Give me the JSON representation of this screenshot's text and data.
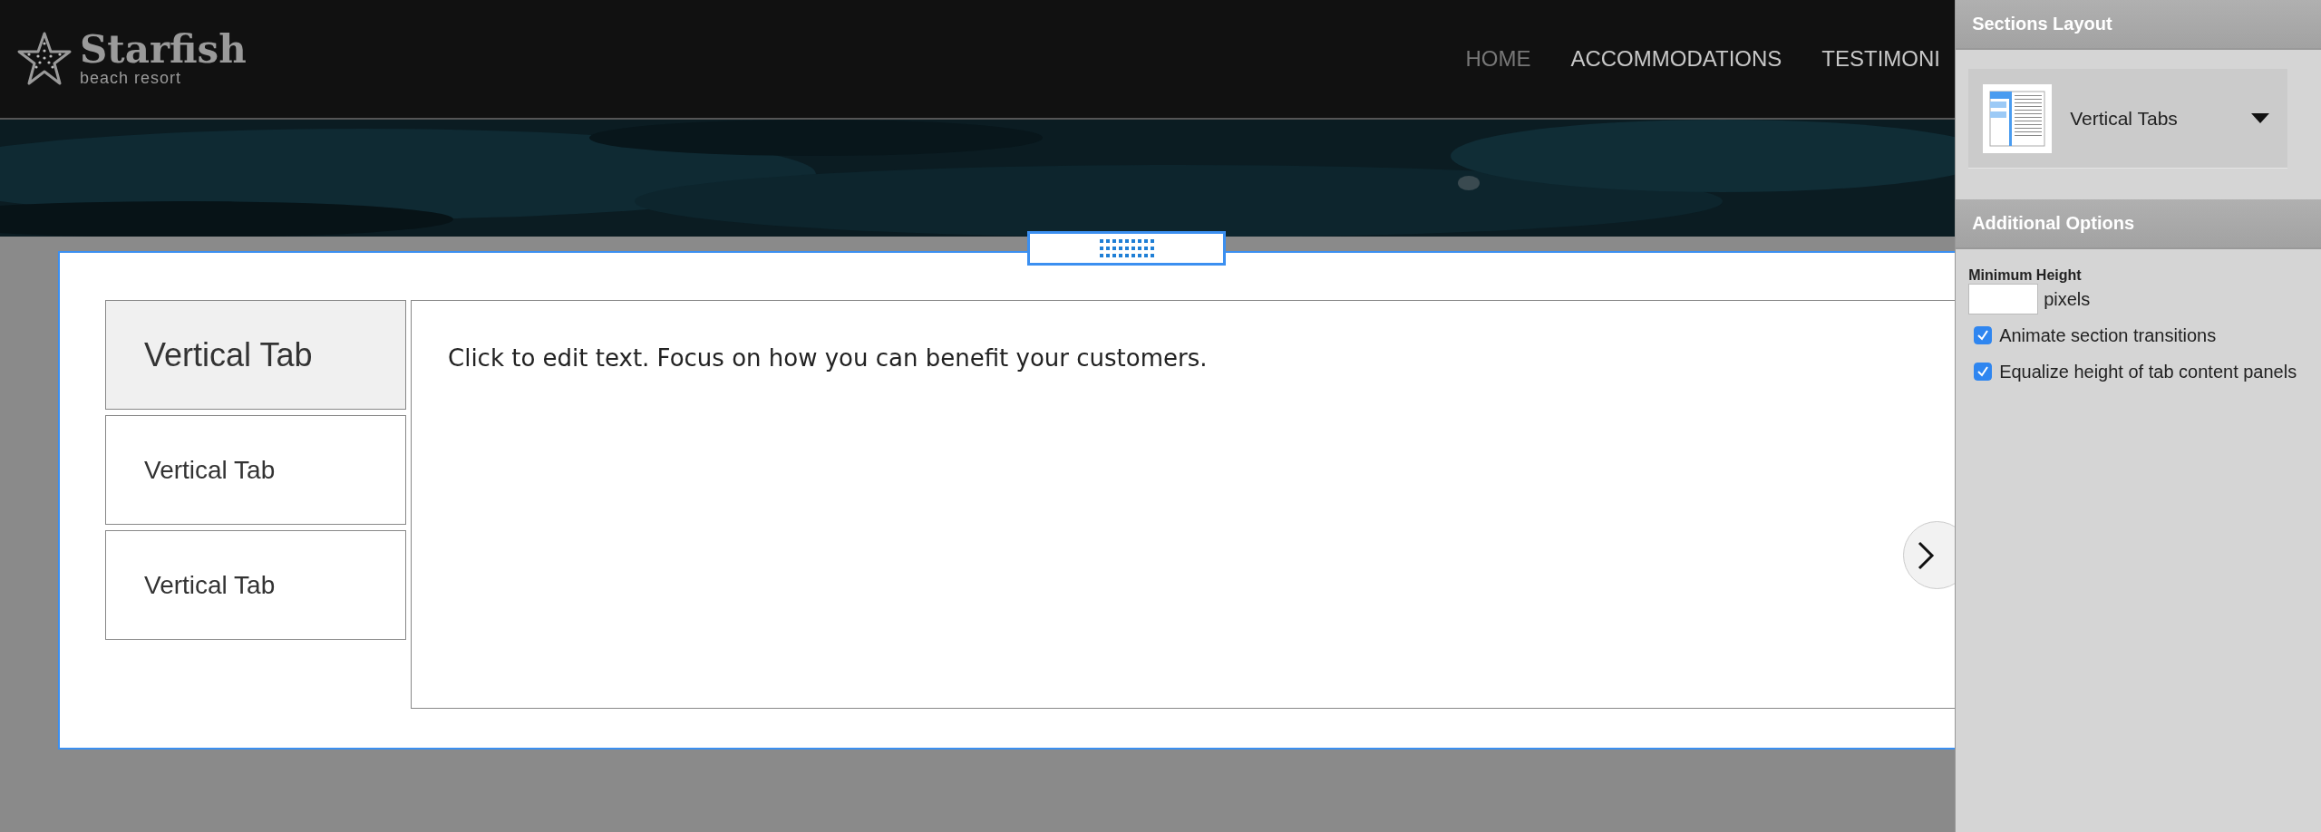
{
  "logo": {
    "name": "Starfish",
    "tagline": "beach resort"
  },
  "nav": [
    {
      "label": "HOME",
      "selected": true
    },
    {
      "label": "ACCOMMODATIONS",
      "selected": false
    },
    {
      "label": "TESTIMONI",
      "selected": false
    }
  ],
  "tabs": [
    {
      "label": "Vertical Tab",
      "selected": true
    },
    {
      "label": "Vertical Tab",
      "selected": false
    },
    {
      "label": "Vertical Tab",
      "selected": false
    }
  ],
  "content": {
    "text": "Click to edit text. Focus on how you can benefit your customers."
  },
  "panel": {
    "sections_layout": {
      "title": "Sections Layout",
      "layout": "Vertical Tabs"
    },
    "additional_options": {
      "title": "Additional Options",
      "min_height_label": "Minimum Height",
      "unit": "pixels",
      "options": [
        {
          "label": "Animate section transitions",
          "checked": true
        },
        {
          "label": "Equalize height of tab content panels",
          "checked": true
        }
      ]
    }
  }
}
